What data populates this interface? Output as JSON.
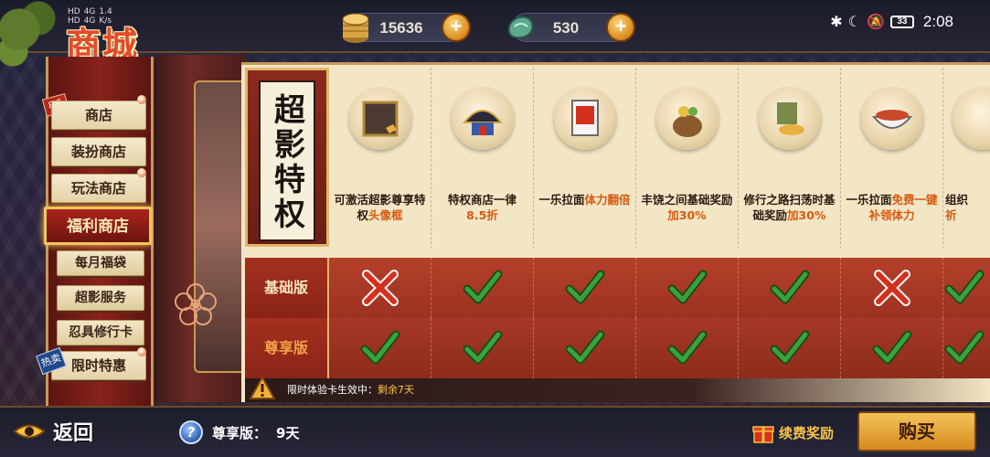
{
  "status_bar": {
    "network_left": [
      "HD",
      "4G",
      "HD",
      "4G"
    ],
    "speed": "1.4",
    "speed_unit": "K/s",
    "battery": "33",
    "time": "2:08"
  },
  "header": {
    "title": "商城",
    "resources": [
      {
        "icon": "coin-stack-icon",
        "value": "15636"
      },
      {
        "icon": "jade-icon",
        "value": "530"
      }
    ]
  },
  "sidebar": {
    "badge_discount": "8.5折",
    "badge_hot": "热卖",
    "items": [
      {
        "label": "商店",
        "active": false,
        "sub": false
      },
      {
        "label": "装扮商店",
        "active": false,
        "sub": false
      },
      {
        "label": "玩法商店",
        "active": false,
        "sub": false
      },
      {
        "label": "福利商店",
        "active": true,
        "sub": false
      },
      {
        "label": "每月福袋",
        "active": false,
        "sub": true
      },
      {
        "label": "超影服务",
        "active": false,
        "sub": true
      },
      {
        "label": "忍具修行卡",
        "active": false,
        "sub": true
      },
      {
        "label": "限时特惠",
        "active": false,
        "sub": true
      }
    ]
  },
  "privilege_table": {
    "title": "超影特权",
    "rows": [
      "基础版",
      "尊享版"
    ],
    "columns": [
      {
        "icon": "avatar-frame-icon",
        "desc_parts": [
          {
            "t": "可激活超影尊享特权",
            "hl": false
          },
          {
            "t": "头像框",
            "hl": true
          }
        ],
        "basic": false,
        "premium": true
      },
      {
        "icon": "shop-hat-icon",
        "desc_parts": [
          {
            "t": "特权商店一律",
            "hl": false
          },
          {
            "t": "8.5折",
            "hl": true
          }
        ],
        "basic": true,
        "premium": true
      },
      {
        "icon": "ramen-ticket-icon",
        "desc_parts": [
          {
            "t": "一乐拉面",
            "hl": false
          },
          {
            "t": "体力翻倍",
            "hl": true
          }
        ],
        "basic": true,
        "premium": true
      },
      {
        "icon": "money-bag-icon",
        "desc_parts": [
          {
            "t": "丰饶之间基础奖励",
            "hl": false
          },
          {
            "t": "加30%",
            "hl": true
          }
        ],
        "basic": true,
        "premium": true
      },
      {
        "icon": "gold-pile-icon",
        "desc_parts": [
          {
            "t": "修行之路扫荡时基础奖励",
            "hl": false
          },
          {
            "t": "加30%",
            "hl": true
          }
        ],
        "basic": true,
        "premium": true
      },
      {
        "icon": "ramen-bowl-icon",
        "desc_parts": [
          {
            "t": "一乐拉面",
            "hl": false
          },
          {
            "t": "免费一键补领体力",
            "hl": true
          }
        ],
        "basic": false,
        "premium": true
      },
      {
        "icon": "scroll-icon",
        "desc_parts": [
          {
            "t": "组织",
            "hl": false
          },
          {
            "t": "祈",
            "hl": true
          }
        ],
        "basic": true,
        "premium": true
      }
    ],
    "notice_prefix": "限时体验卡生效中：",
    "notice_highlight": "剩余7天"
  },
  "footer": {
    "back_label": "返回",
    "vip_label": "尊享版：",
    "vip_days": "9天",
    "renew_label": "续费奖励",
    "buy_label": "购买"
  },
  "colors": {
    "highlight": "#d75a12",
    "check": "#3aa23a",
    "cross": "#d4301c",
    "gold": "#f7c44a"
  }
}
